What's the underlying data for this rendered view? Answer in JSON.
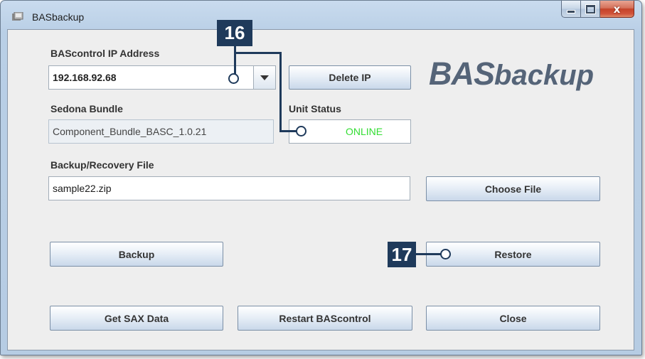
{
  "window": {
    "title": "BASbackup",
    "minimize_glyph": "",
    "maximize_glyph": "",
    "close_glyph": "x"
  },
  "ip": {
    "label": "BAScontrol IP Address",
    "value": "192.168.92.68",
    "delete_label": "Delete IP"
  },
  "logo": {
    "bold": "BAS",
    "rest": "backup"
  },
  "bundle": {
    "label": "Sedona Bundle",
    "value": "Component_Bundle_BASC_1.0.21"
  },
  "status": {
    "label": "Unit Status",
    "value": "ONLINE",
    "color": "#33dd33"
  },
  "file": {
    "label": "Backup/Recovery File",
    "value": "sample22.zip",
    "choose_label": "Choose File"
  },
  "buttons": {
    "backup": "Backup",
    "restore": "Restore",
    "get_sax": "Get SAX Data",
    "restart": "Restart BAScontrol",
    "close": "Close"
  },
  "callouts": {
    "c16": "16",
    "c17": "17"
  },
  "colors": {
    "callout": "#1f3a5b",
    "button_top": "#ffffff",
    "button_bottom": "#c9d8ea"
  }
}
